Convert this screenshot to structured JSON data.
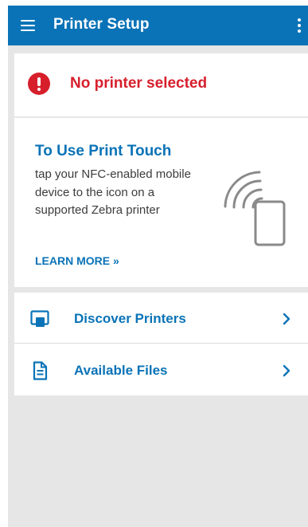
{
  "appbar": {
    "title": "Printer Setup",
    "color": "#0a73b7"
  },
  "status": {
    "message": "No printer selected",
    "icon": "alert-icon",
    "color": "#d71f2c"
  },
  "info": {
    "title": "To Use Print Touch",
    "body": "tap your NFC-enabled mobile device to the icon on a supported Zebra printer",
    "link_label": "LEARN MORE »",
    "icon": "nfc-phone-icon"
  },
  "nav": {
    "items": [
      {
        "label": "Discover Printers",
        "icon": "discover-printers-icon"
      },
      {
        "label": "Available Files",
        "icon": "document-icon"
      }
    ]
  }
}
